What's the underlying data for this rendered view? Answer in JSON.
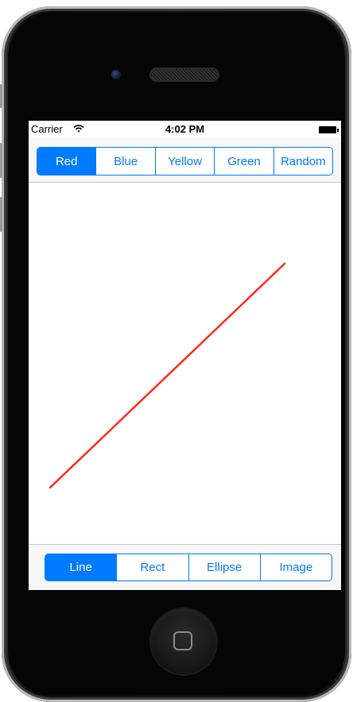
{
  "status_bar": {
    "carrier": "Carrier",
    "time": "4:02 PM"
  },
  "color_segments": {
    "items": [
      "Red",
      "Blue",
      "Yellow",
      "Green",
      "Random"
    ],
    "selected_index": 0
  },
  "shape_segments": {
    "items": [
      "Line",
      "Rect",
      "Ellipse",
      "Image"
    ],
    "selected_index": 0
  },
  "drawing": {
    "stroke_color": "#ff2a1a",
    "accent_color": "#007aff"
  }
}
